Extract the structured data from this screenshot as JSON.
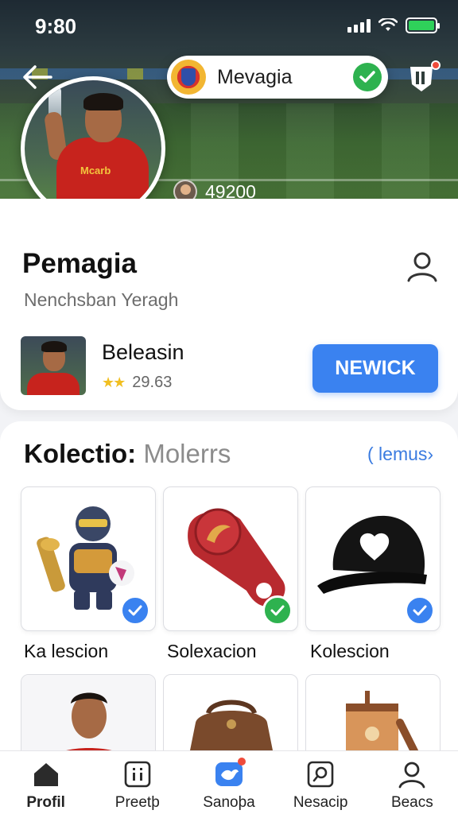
{
  "status_bar": {
    "time": "9:80"
  },
  "header": {
    "club_name": "Mevagia",
    "follower_count": "49200"
  },
  "profile": {
    "name": "Pemagia",
    "subtitle": "Nenchsban Yeragh"
  },
  "featured": {
    "title": "Beleasin",
    "stars": "★★",
    "rating": "29.63",
    "cta_label": "NEWICK"
  },
  "collection": {
    "title_bold": "Kolectio:",
    "title_muted": "Molerrs",
    "link_label": "( lemus",
    "items": [
      {
        "label": "Ka lescion",
        "icon": "knight-figurine-icon"
      },
      {
        "label": "Solexacion",
        "icon": "bottle-opener-icon"
      },
      {
        "label": "Kolescion",
        "icon": "cap-icon"
      }
    ]
  },
  "nav": {
    "items": [
      {
        "label": "Profil",
        "icon": "home-icon"
      },
      {
        "label": "Preetþ",
        "icon": "scoreboard-icon"
      },
      {
        "label": "Sanoþa",
        "icon": "bird-icon"
      },
      {
        "label": "Nesacip",
        "icon": "search-icon"
      },
      {
        "label": "Beacs",
        "icon": "person-icon"
      }
    ]
  },
  "colors": {
    "accent": "#3a82f0",
    "check": "#2eb24f",
    "link": "#3a7be0",
    "notification": "#ef4b3b"
  }
}
